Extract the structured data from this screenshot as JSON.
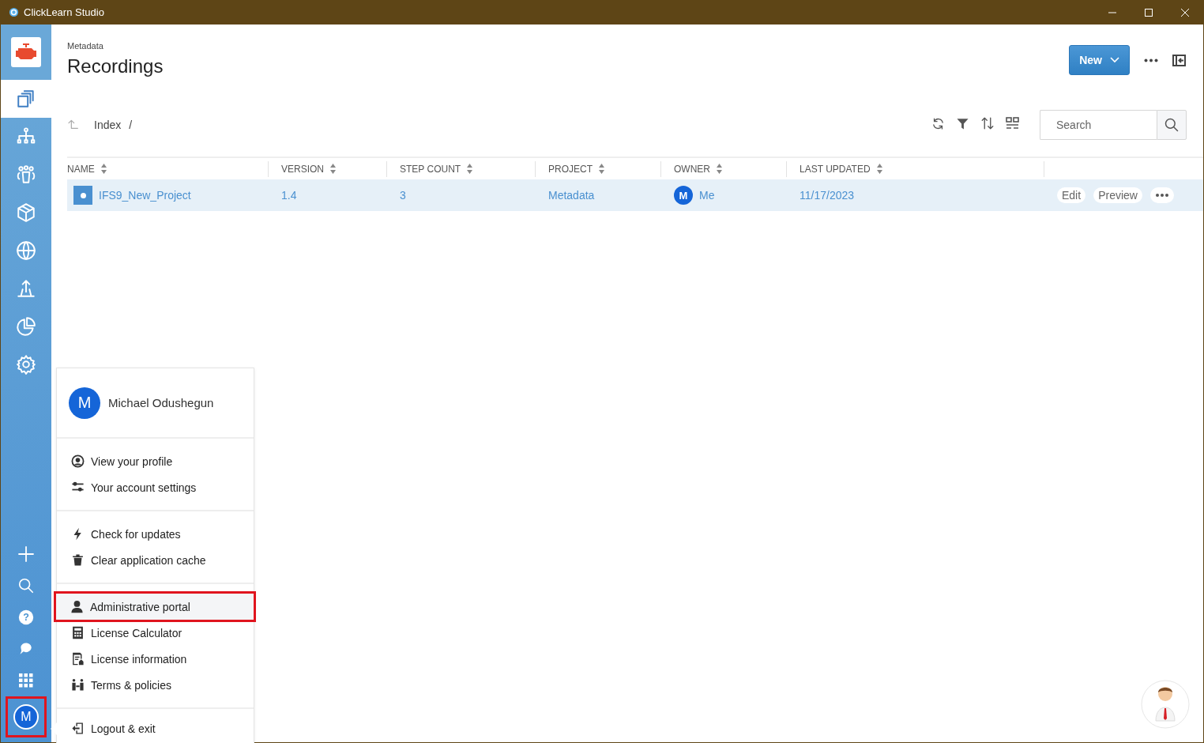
{
  "window": {
    "title": "ClickLearn Studio"
  },
  "sidebar": {
    "items": [
      {
        "kind": "documents",
        "selected": true
      },
      {
        "kind": "hierarchy",
        "selected": false
      },
      {
        "kind": "people",
        "selected": false
      },
      {
        "kind": "box",
        "selected": false
      },
      {
        "kind": "globe",
        "selected": false
      },
      {
        "kind": "publish",
        "selected": false
      },
      {
        "kind": "chart",
        "selected": false
      },
      {
        "kind": "settings",
        "selected": false
      }
    ],
    "tools": [
      {
        "kind": "plus"
      },
      {
        "kind": "search"
      },
      {
        "kind": "help",
        "glyph": "?"
      },
      {
        "kind": "chat"
      },
      {
        "kind": "apps"
      }
    ],
    "avatar": {
      "initial": "M",
      "highlighted": true
    }
  },
  "header": {
    "breadcrumb": "Metadata",
    "title": "Recordings",
    "new_button": "New"
  },
  "path": {
    "items": [
      "Index",
      "/"
    ]
  },
  "search": {
    "placeholder": "Search"
  },
  "table": {
    "columns": [
      "NAME",
      "VERSION",
      "STEP COUNT",
      "PROJECT",
      "OWNER",
      "LAST UPDATED"
    ],
    "rows": [
      {
        "name": "IFS9_New_Project",
        "version": "1.4",
        "step_count": "3",
        "project": "Metadata",
        "owner_initial": "M",
        "owner": "Me",
        "last_updated": "11/17/2023",
        "selected": true,
        "actions": [
          "Edit",
          "Preview"
        ]
      }
    ]
  },
  "user_menu": {
    "user": {
      "initial": "M",
      "name": "Michael Odushegun"
    },
    "sections": [
      [
        {
          "kind": "profile",
          "label": "View your profile",
          "highlighted": false
        },
        {
          "kind": "sliders",
          "label": "Your account settings",
          "highlighted": false
        }
      ],
      [
        {
          "kind": "bolt",
          "label": "Check for updates",
          "highlighted": false
        },
        {
          "kind": "trash",
          "label": "Clear application cache",
          "highlighted": false
        }
      ],
      [
        {
          "kind": "person",
          "label": "Administrative portal",
          "highlighted": true
        },
        {
          "kind": "calculator",
          "label": "License Calculator",
          "highlighted": false
        },
        {
          "kind": "document",
          "label": "License information",
          "highlighted": false
        },
        {
          "kind": "scale",
          "label": "Terms & policies",
          "highlighted": false
        }
      ],
      [
        {
          "kind": "logout",
          "label": "Logout & exit",
          "highlighted": false
        }
      ]
    ]
  }
}
